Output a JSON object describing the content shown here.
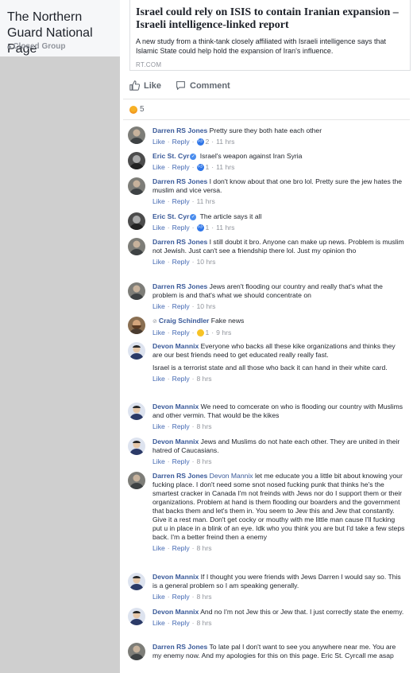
{
  "group": {
    "title": "The Northern Guard National Page",
    "privacy": "Closed Group"
  },
  "post": {
    "link_title": "Israel could rely on ISIS to contain Iranian expansion – Israeli intelligence-linked report",
    "link_description": "A new study from a think-tank closely affiliated with Israeli intelligence says that Islamic State could help hold the expansion of Iran's influence.",
    "link_domain": "RT.COM",
    "like_label": "Like",
    "comment_label": "Comment",
    "reaction_count": "5"
  },
  "labels": {
    "like": "Like",
    "reply": "Reply",
    "sep": "·"
  },
  "comments": [
    {
      "author": "Darren RS Jones",
      "text": "Pretty sure they both hate each other",
      "reaction_count": "2",
      "time": "11 hrs"
    },
    {
      "author": "Eric St. Cyr",
      "text": "Israel's weapon against Iran Syria",
      "reaction_count": "1",
      "time": "11 hrs"
    },
    {
      "author": "Darren RS Jones",
      "text": "I don't know about that one bro lol. Pretty sure the jew hates the muslim and vice versa.",
      "time": "11 hrs"
    },
    {
      "author": "Eric St. Cyr",
      "text": "The article says it all",
      "reaction_count": "1",
      "time": "11 hrs"
    },
    {
      "author": "Darren RS Jones",
      "text": "I still doubt it bro. Anyone can make up news. Problem is muslim not Jewish. Just can't see a friendship there lol. Just my opinion tho",
      "time": "10 hrs"
    },
    {
      "author": "Darren RS Jones",
      "text": "Jews aren't flooding our country and really that's what the problem is and that's what we should concentrate on",
      "time": "10 hrs"
    },
    {
      "author": "Craig Schindler",
      "text": "Fake news",
      "reaction_count": "1",
      "time": "9 hrs"
    },
    {
      "author": "Devon Mannix",
      "text": "Everyone who backs all these kike organizations and thinks they are our best friends need to get educated really really fast.",
      "text2": "Israel is a terrorist state and all those who back it can hand in their white card.",
      "time": "8 hrs"
    },
    {
      "author": "Devon Mannix",
      "text": "We need to comcerate on who is flooding our country with Muslims and other vermin. That would be the kikes",
      "time": "8 hrs"
    },
    {
      "author": "Devon Mannix",
      "text": "Jews and Muslims do not hate each other. They are united in their hatred of Caucasians.",
      "time": "8 hrs"
    },
    {
      "author": "Darren RS Jones",
      "mention": "Devon Mannix",
      "text": "let me educate you a little bit about knowing your fucking place. I don't need some snot nosed fucking punk that thinks he's the smartest cracker in Canada I'm not freinds with Jews nor do I support them or their organizations. Problem at hand is them flooding our boarders and the government that backs them and let's them in. You seem to Jew this and Jew that constantly. Give it a rest man. Don't get cocky or mouthy with me little man cause I'll fucking put u in place in a blink of an eye. Idk who you think you are but I'd take a few steps back. I'm a better freind then a enemy",
      "time": "8 hrs"
    },
    {
      "author": "Devon Mannix",
      "text": "If I thought you were friends with Jews Darren I would say so. This is a general problem so I am speaking generally.",
      "time": "8 hrs"
    },
    {
      "author": "Devon Mannix",
      "text": "And no I'm not Jew this or Jew that. I just correctly state the enemy.",
      "time": "8 hrs"
    },
    {
      "author": "Darren RS Jones",
      "text": "To late pal I don't want to see you anywhere near me. You are my enemy now. And my apologies for this on this page. Eric St. Cyrcall me asap"
    }
  ]
}
